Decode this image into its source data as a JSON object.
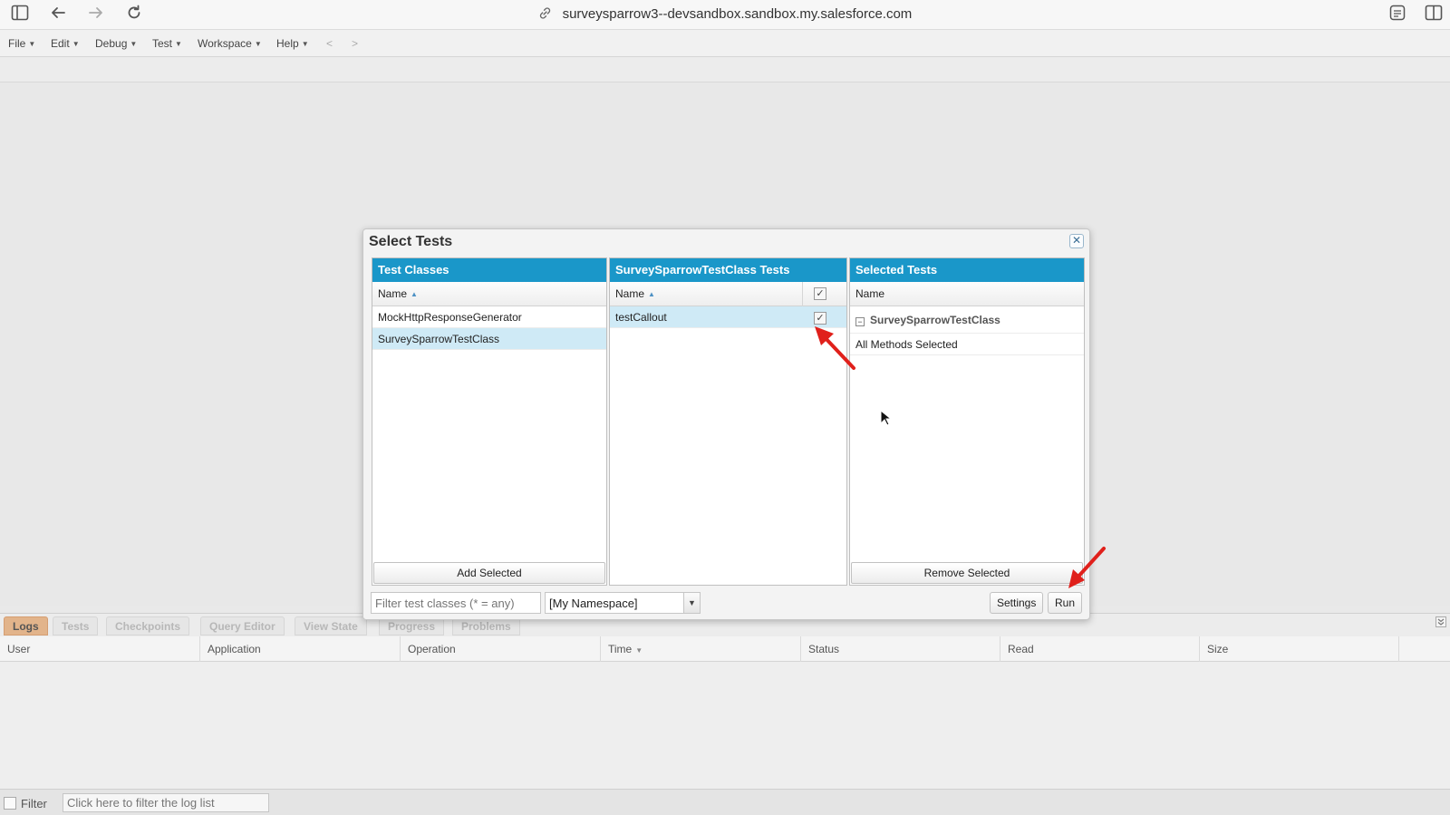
{
  "browser": {
    "url": "surveysparrow3--devsandbox.sandbox.my.salesforce.com"
  },
  "menu": {
    "items": [
      "File",
      "Edit",
      "Debug",
      "Test",
      "Workspace",
      "Help"
    ],
    "nav_back": "<",
    "nav_forward": ">"
  },
  "dialog": {
    "title": "Select Tests",
    "close": "✕",
    "test_classes": {
      "header": "Test Classes",
      "column": "Name",
      "rows": [
        "MockHttpResponseGenerator",
        "SurveySparrowTestClass"
      ],
      "button": "Add Selected"
    },
    "class_tests": {
      "header": "SurveySparrowTestClass Tests",
      "column": "Name",
      "rows": [
        "testCallout"
      ],
      "check_mark": "✓"
    },
    "selected_tests": {
      "header": "Selected Tests",
      "column": "Name",
      "group": "SurveySparrowTestClass",
      "group_toggle": "−",
      "rows": [
        "All Methods Selected"
      ],
      "button": "Remove Selected"
    },
    "filter_placeholder": "Filter test classes (* = any)",
    "namespace": "[My Namespace]",
    "settings_label": "Settings",
    "run_label": "Run"
  },
  "bottom_tabs": [
    "Logs",
    "Tests",
    "Checkpoints",
    "Query Editor",
    "View State",
    "Progress",
    "Problems"
  ],
  "log_columns": [
    "User",
    "Application",
    "Operation",
    "Time",
    "Status",
    "Read",
    "Size"
  ],
  "log_filter": {
    "label": "Filter",
    "placeholder": "Click here to filter the log list"
  },
  "colors": {
    "panel_header": "#1a97c9",
    "row_selected": "#cfeaf6",
    "active_tab": "#e2b48b",
    "annotation_arrow": "#e0201b"
  }
}
